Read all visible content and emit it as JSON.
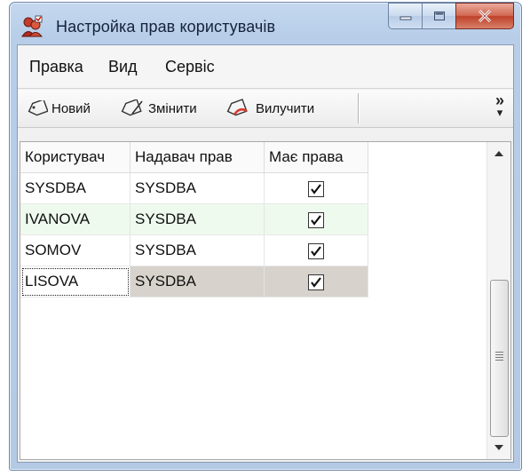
{
  "window": {
    "title": "Настройка прав користувачів"
  },
  "menu": {
    "items": [
      "Правка",
      "Вид",
      "Сервіс"
    ]
  },
  "toolbar": {
    "new_label": "Новий",
    "edit_label": "Змінити",
    "delete_label": "Вилучити",
    "overflow_glyph": "»"
  },
  "grid": {
    "columns": [
      "Користувач",
      "Надавач прав",
      "Має права"
    ],
    "rows": [
      {
        "user": "SYSDBA",
        "grantor": "SYSDBA",
        "has_rights": true
      },
      {
        "user": "IVANOVA",
        "grantor": "SYSDBA",
        "has_rights": true
      },
      {
        "user": "SOMOV",
        "grantor": "SYSDBA",
        "has_rights": true
      },
      {
        "user": "LISOVA",
        "grantor": "SYSDBA",
        "has_rights": true
      }
    ]
  },
  "colors": {
    "alt_row": "#eefaee",
    "selected_row": "#d7d3cc",
    "close_button": "#c0412a"
  }
}
